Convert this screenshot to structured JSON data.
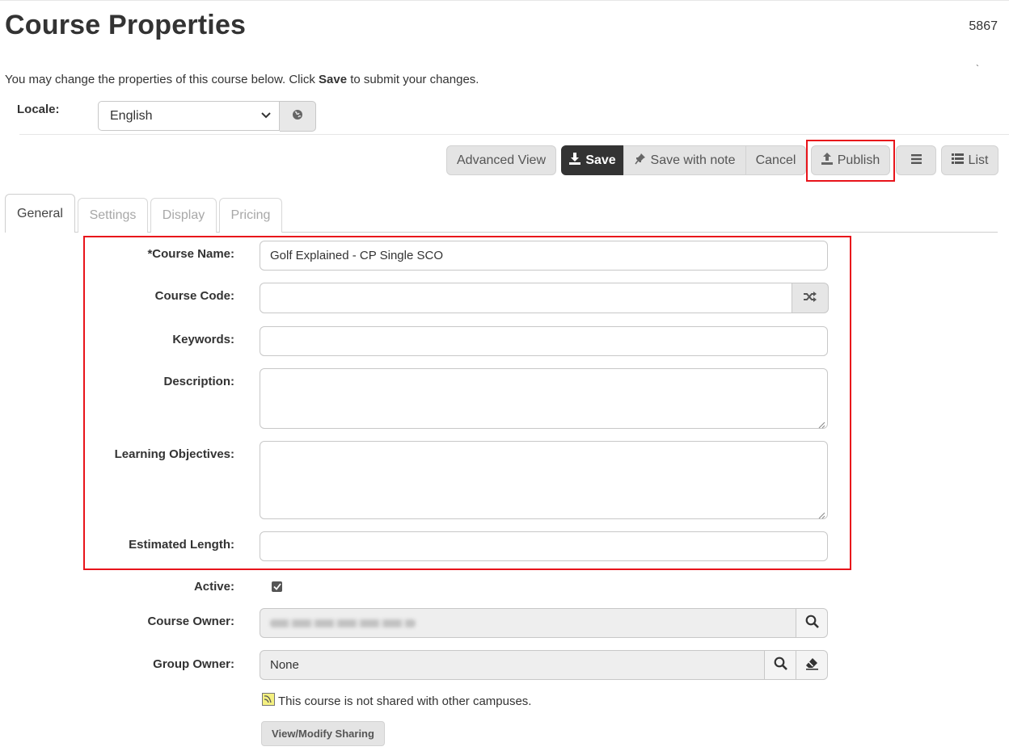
{
  "page": {
    "title": "Course Properties",
    "course_id": "5867",
    "tick_mark": "`",
    "intro_before": "You may change the properties of this course below. Click ",
    "intro_bold": "Save",
    "intro_after": " to submit your changes."
  },
  "locale": {
    "label": "Locale:",
    "selected": "English"
  },
  "toolbar": {
    "advanced_view": "Advanced View",
    "save": "Save",
    "save_with_note": "Save with note",
    "cancel": "Cancel",
    "publish": "Publish",
    "list": "List"
  },
  "tabs": [
    {
      "label": "General",
      "active": true
    },
    {
      "label": "Settings",
      "active": false
    },
    {
      "label": "Display",
      "active": false
    },
    {
      "label": "Pricing",
      "active": false
    }
  ],
  "form": {
    "course_name_label": "*Course Name:",
    "course_name_value": "Golf Explained - CP Single SCO",
    "course_code_label": "Course Code:",
    "course_code_value": "",
    "keywords_label": "Keywords:",
    "keywords_value": "",
    "description_label": "Description:",
    "learning_objectives_label": "Learning Objectives:",
    "estimated_length_label": "Estimated Length:",
    "estimated_length_value": "",
    "active_label": "Active:",
    "active_checked": true,
    "course_owner_label": "Course Owner:",
    "group_owner_label": "Group Owner:",
    "group_owner_value": "None"
  },
  "sharing": {
    "note": "This course is not shared with other campuses.",
    "button": "View/Modify Sharing"
  },
  "colors": {
    "highlight": "#e8141b",
    "primary_button": "#333333",
    "button_bg": "#e4e4e4"
  }
}
